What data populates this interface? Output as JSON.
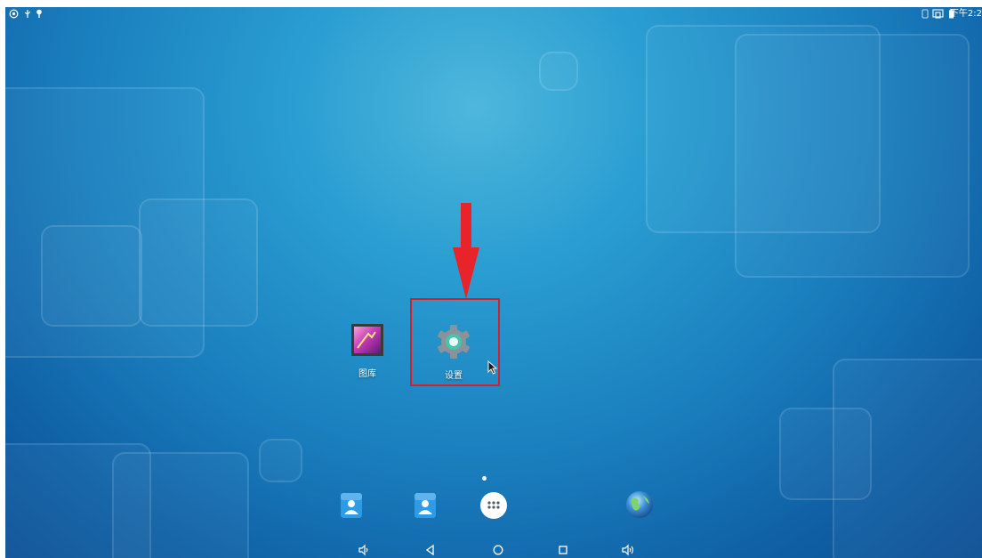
{
  "status_bar": {
    "left_icons": [
      "android-debug-icon",
      "usb-icon",
      "location-pin-icon"
    ],
    "right_icons": [
      "sim-icon",
      "screen-cast-icon",
      "battery-icon"
    ],
    "clock": "下午2:2"
  },
  "desktop": {
    "apps": [
      {
        "name": "gallery",
        "label": "图库",
        "icon": "gallery-icon"
      },
      {
        "name": "settings",
        "label": "设置",
        "icon": "gear-icon"
      }
    ],
    "annotation": {
      "arrow_color": "#e8232a",
      "box_color": "#d5202a"
    }
  },
  "dock": {
    "items": [
      {
        "name": "contacts",
        "icon": "contacts-icon"
      },
      {
        "name": "contacts-2",
        "icon": "contacts-icon"
      },
      {
        "name": "all-apps",
        "icon": "app-drawer-icon"
      },
      {
        "name": "browser",
        "icon": "globe-icon"
      }
    ]
  },
  "nav_bar": {
    "buttons": [
      "volume-down-icon",
      "back-icon",
      "home-icon",
      "recents-icon",
      "volume-up-icon"
    ]
  },
  "colors": {
    "wallpaper_top": "#4fb7dc",
    "wallpaper_bottom": "#0c4f93",
    "highlight": "#d5202a"
  }
}
